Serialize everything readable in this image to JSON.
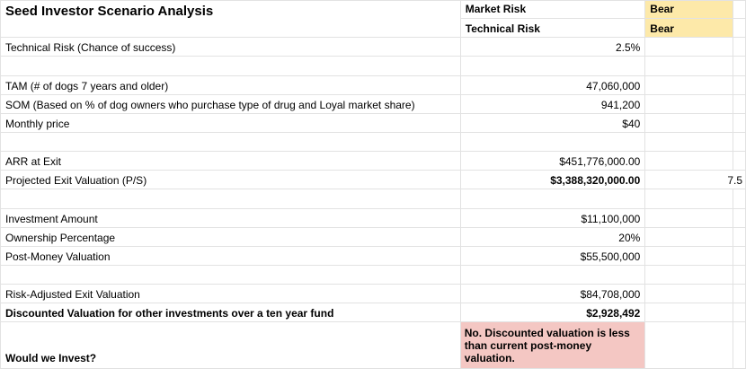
{
  "sheet": {
    "title": "Seed Investor Scenario Analysis",
    "header": {
      "market_risk_label": "Market Risk",
      "market_risk_value": "Bear",
      "technical_risk_label": "Technical Risk",
      "technical_risk_value": "Bear"
    },
    "rows": {
      "technical_risk": {
        "label": "Technical Risk (Chance of success)",
        "value": "2.5%"
      },
      "tam": {
        "label": "TAM (# of dogs 7 years and older)",
        "value": "47,060,000"
      },
      "som": {
        "label": "SOM (Based on % of dog owners who purchase type of drug and Loyal market share)",
        "value": "941,200"
      },
      "monthly_price": {
        "label": "Monthly price",
        "value": "$40"
      },
      "arr": {
        "label": "ARR at Exit",
        "value": "$451,776,000.00"
      },
      "exit_valuation": {
        "label": "Projected Exit Valuation (P/S)",
        "value": "$3,388,320,000.00",
        "multiple": "7.5"
      },
      "investment_amount": {
        "label": "Investment Amount",
        "value": "$11,100,000"
      },
      "ownership": {
        "label": "Ownership Percentage",
        "value": "20%"
      },
      "post_money": {
        "label": "Post-Money Valuation",
        "value": "$55,500,000"
      },
      "risk_adjusted": {
        "label": "Risk-Adjusted Exit Valuation",
        "value": "$84,708,000"
      },
      "discounted": {
        "label": "Discounted Valuation for other investments over a ten year fund",
        "value": "$2,928,492"
      },
      "invest": {
        "label": "Would we Invest?",
        "value": "No. Discounted valuation is less than current post-money valuation."
      }
    },
    "colors": {
      "bear_fill": "#fde9a9",
      "answer_fill": "#f4c7c3",
      "grid": "#e2e2e2"
    }
  }
}
